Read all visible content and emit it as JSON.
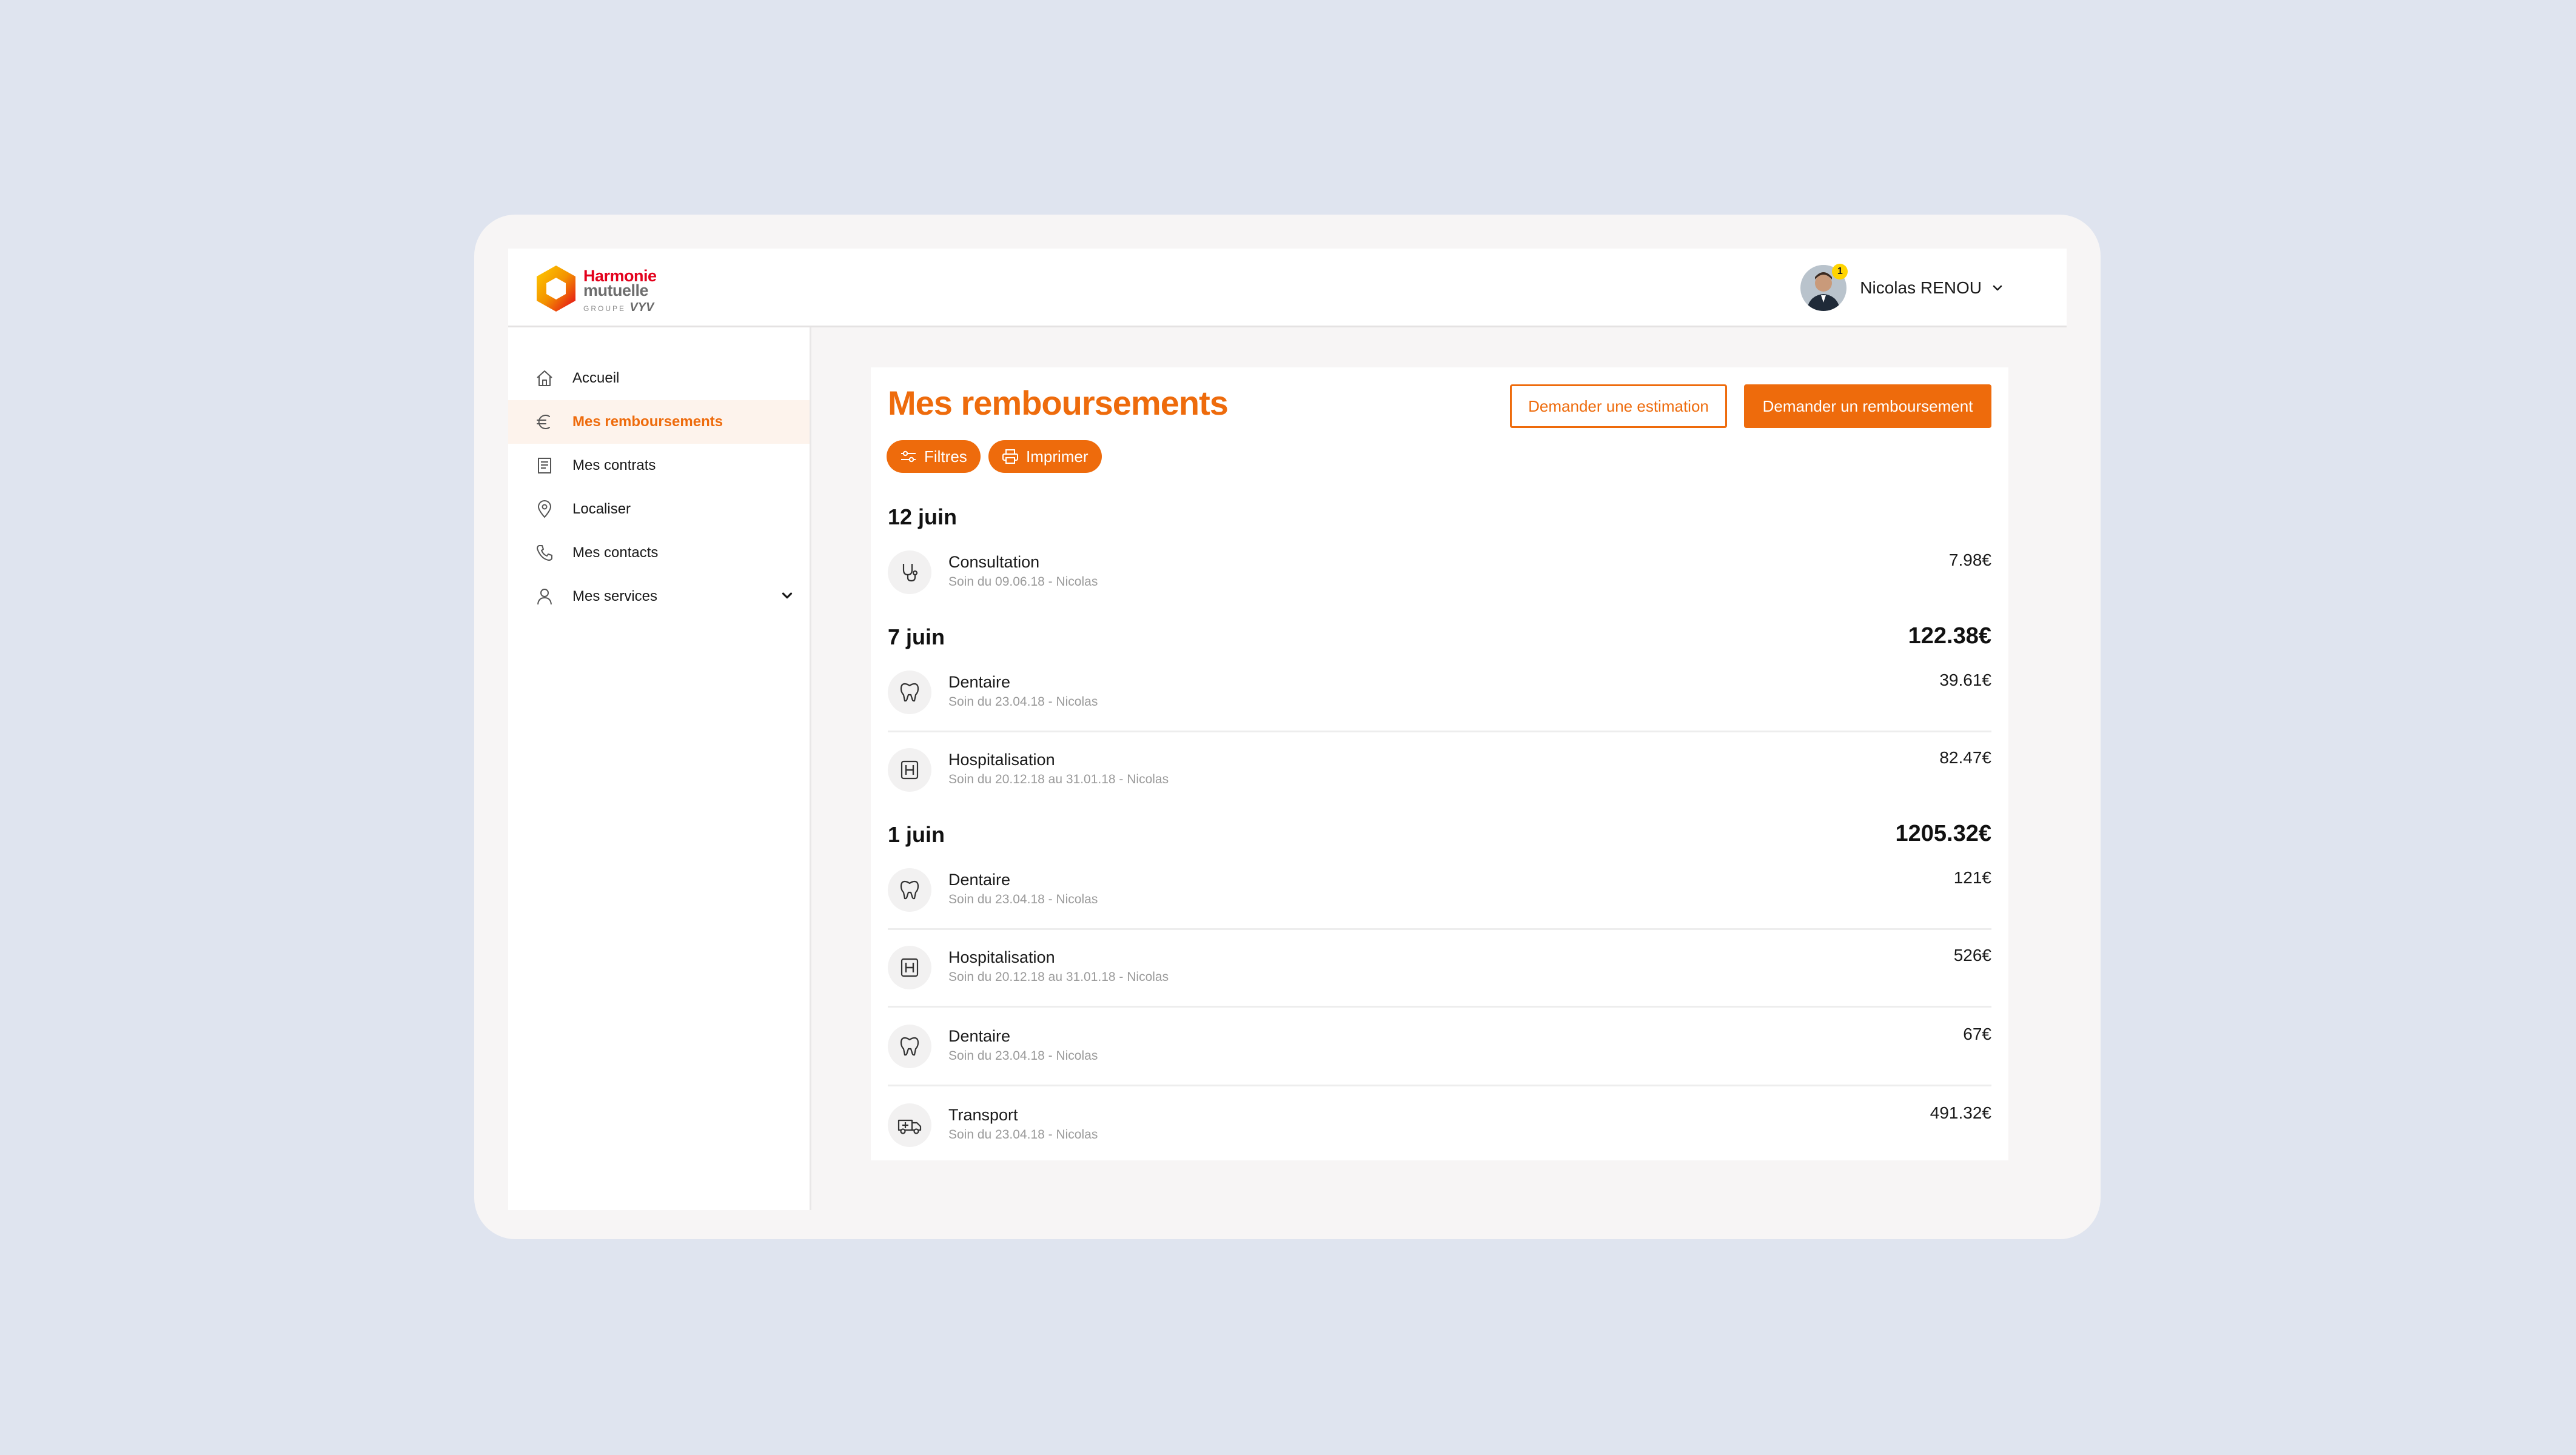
{
  "brand": {
    "line1": "Harmonie",
    "line2": "mutuelle",
    "group_prefix": "GROUPE",
    "group_name": "VYV"
  },
  "user": {
    "name": "Nicolas RENOU",
    "notifications": "1"
  },
  "colors": {
    "accent": "#ee6b0c",
    "brand_red": "#e3001b",
    "background": "#dfe4ef"
  },
  "sidebar": {
    "items": [
      {
        "label": "Accueil",
        "icon": "home-icon"
      },
      {
        "label": "Mes remboursements",
        "icon": "euro-icon",
        "active": true
      },
      {
        "label": "Mes contrats",
        "icon": "document-icon"
      },
      {
        "label": "Localiser",
        "icon": "location-pin-icon"
      },
      {
        "label": "Mes contacts",
        "icon": "phone-icon"
      },
      {
        "label": "Mes services",
        "icon": "user-icon",
        "expandable": true
      }
    ]
  },
  "main": {
    "title": "Mes remboursements",
    "estimate_button": "Demander une estimation",
    "refund_button": "Demander un remboursement",
    "filters_label": "Filtres",
    "print_label": "Imprimer",
    "groups": [
      {
        "date": "12 juin",
        "total": "",
        "items": [
          {
            "title": "Consultation",
            "subtitle": "Soin du 09.06.18 - Nicolas",
            "amount": "7.98€",
            "icon": "stethoscope-icon"
          }
        ]
      },
      {
        "date": "7 juin",
        "total": "122.38€",
        "items": [
          {
            "title": "Dentaire",
            "subtitle": "Soin du 23.04.18 - Nicolas",
            "amount": "39.61€",
            "icon": "tooth-icon"
          },
          {
            "title": "Hospitalisation",
            "subtitle": "Soin du 20.12.18 au 31.01.18 - Nicolas",
            "amount": "82.47€",
            "icon": "hospital-icon"
          }
        ]
      },
      {
        "date": "1 juin",
        "total": "1205.32€",
        "items": [
          {
            "title": "Dentaire",
            "subtitle": "Soin du 23.04.18 - Nicolas",
            "amount": "121€",
            "icon": "tooth-icon"
          },
          {
            "title": "Hospitalisation",
            "subtitle": "Soin du 20.12.18 au 31.01.18 - Nicolas",
            "amount": "526€",
            "icon": "hospital-icon"
          },
          {
            "title": "Dentaire",
            "subtitle": "Soin du 23.04.18 - Nicolas",
            "amount": "67€",
            "icon": "tooth-icon"
          },
          {
            "title": "Transport",
            "subtitle": "Soin du 23.04.18 - Nicolas",
            "amount": "491.32€",
            "icon": "ambulance-icon"
          }
        ]
      }
    ]
  }
}
